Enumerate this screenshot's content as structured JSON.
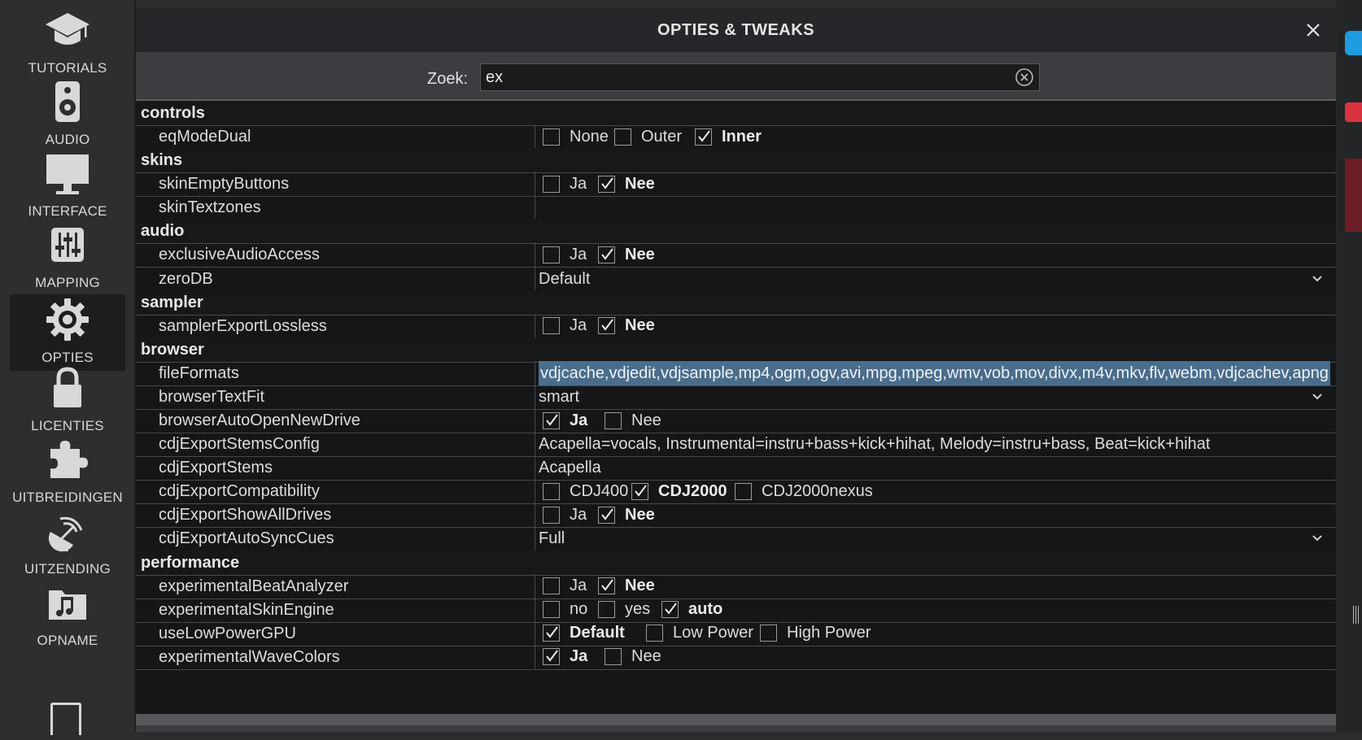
{
  "sidebar": {
    "items": [
      {
        "label": "TUTORIALS",
        "icon": "graduation-cap-icon",
        "active": false
      },
      {
        "label": "AUDIO",
        "icon": "speaker-icon",
        "active": false
      },
      {
        "label": "INTERFACE",
        "icon": "monitor-icon",
        "active": false
      },
      {
        "label": "MAPPING",
        "icon": "sliders-icon",
        "active": false
      },
      {
        "label": "OPTIES",
        "icon": "gear-icon",
        "active": true
      },
      {
        "label": "LICENTIES",
        "icon": "lock-icon",
        "active": false
      },
      {
        "label": "UITBREIDINGEN",
        "icon": "puzzle-icon",
        "active": false
      },
      {
        "label": "UITZENDING",
        "icon": "broadcast-icon",
        "active": false
      },
      {
        "label": "OPNAME",
        "icon": "music-folder-icon",
        "active": false
      }
    ]
  },
  "dialog": {
    "title": "OPTIES & TWEAKS",
    "search": {
      "label": "Zoek:",
      "value": "ex"
    }
  },
  "rows": [
    {
      "type": "section",
      "label": "controls"
    },
    {
      "type": "checks",
      "name": "eqModeDual",
      "options": [
        {
          "label": "None",
          "checked": false
        },
        {
          "label": "Outer",
          "checked": false
        },
        {
          "label": "Inner",
          "checked": true
        }
      ]
    },
    {
      "type": "section",
      "label": "skins"
    },
    {
      "type": "checks",
      "name": "skinEmptyButtons",
      "options": [
        {
          "label": "Ja",
          "checked": false
        },
        {
          "label": "Nee",
          "checked": true
        }
      ]
    },
    {
      "type": "text",
      "name": "skinTextzones",
      "value": ""
    },
    {
      "type": "section",
      "label": "audio"
    },
    {
      "type": "checks",
      "name": "exclusiveAudioAccess",
      "options": [
        {
          "label": "Ja",
          "checked": false
        },
        {
          "label": "Nee",
          "checked": true
        }
      ]
    },
    {
      "type": "select",
      "name": "zeroDB",
      "value": "Default"
    },
    {
      "type": "section",
      "label": "sampler"
    },
    {
      "type": "checks",
      "name": "samplerExportLossless",
      "options": [
        {
          "label": "Ja",
          "checked": false
        },
        {
          "label": "Nee",
          "checked": true
        }
      ]
    },
    {
      "type": "section",
      "label": "browser"
    },
    {
      "type": "text",
      "name": "fileFormats",
      "value": "vdjcache,vdjedit,vdjsample,mp4,ogm,ogv,avi,mpg,mpeg,wmv,vob,mov,divx,m4v,mkv,flv,webm,vdjcachev,apng",
      "selected": true
    },
    {
      "type": "select",
      "name": "browserTextFit",
      "value": "smart"
    },
    {
      "type": "checks",
      "name": "browserAutoOpenNewDrive",
      "options": [
        {
          "label": "Ja",
          "checked": true
        },
        {
          "label": "Nee",
          "checked": false
        }
      ]
    },
    {
      "type": "text",
      "name": "cdjExportStemsConfig",
      "value": "Acapella=vocals, Instrumental=instru+bass+kick+hihat, Melody=instru+bass, Beat=kick+hihat"
    },
    {
      "type": "text",
      "name": "cdjExportStems",
      "value": "Acapella"
    },
    {
      "type": "checks",
      "name": "cdjExportCompatibility",
      "options": [
        {
          "label": "CDJ400",
          "checked": false
        },
        {
          "label": "CDJ2000",
          "checked": true
        },
        {
          "label": "CDJ2000nexus",
          "checked": false
        }
      ]
    },
    {
      "type": "checks",
      "name": "cdjExportShowAllDrives",
      "options": [
        {
          "label": "Ja",
          "checked": false
        },
        {
          "label": "Nee",
          "checked": true
        }
      ]
    },
    {
      "type": "select",
      "name": "cdjExportAutoSyncCues",
      "value": "Full"
    },
    {
      "type": "section",
      "label": "performance"
    },
    {
      "type": "checks",
      "name": "experimentalBeatAnalyzer",
      "options": [
        {
          "label": "Ja",
          "checked": false
        },
        {
          "label": "Nee",
          "checked": true
        }
      ]
    },
    {
      "type": "checks",
      "name": "experimentalSkinEngine",
      "options": [
        {
          "label": "no",
          "checked": false
        },
        {
          "label": "yes",
          "checked": false
        },
        {
          "label": "auto",
          "checked": true
        }
      ]
    },
    {
      "type": "checks",
      "name": "useLowPowerGPU",
      "options": [
        {
          "label": "Default",
          "checked": true
        },
        {
          "label": "Low Power",
          "checked": false
        },
        {
          "label": "High Power",
          "checked": false
        }
      ]
    },
    {
      "type": "checks",
      "name": "experimentalWaveColors",
      "options": [
        {
          "label": "Ja",
          "checked": true
        },
        {
          "label": "Nee",
          "checked": false
        }
      ]
    }
  ],
  "colors": {
    "accent_blue": "#1f9be0",
    "accent_red": "#d9333f",
    "selection": "#4a6d8c"
  }
}
